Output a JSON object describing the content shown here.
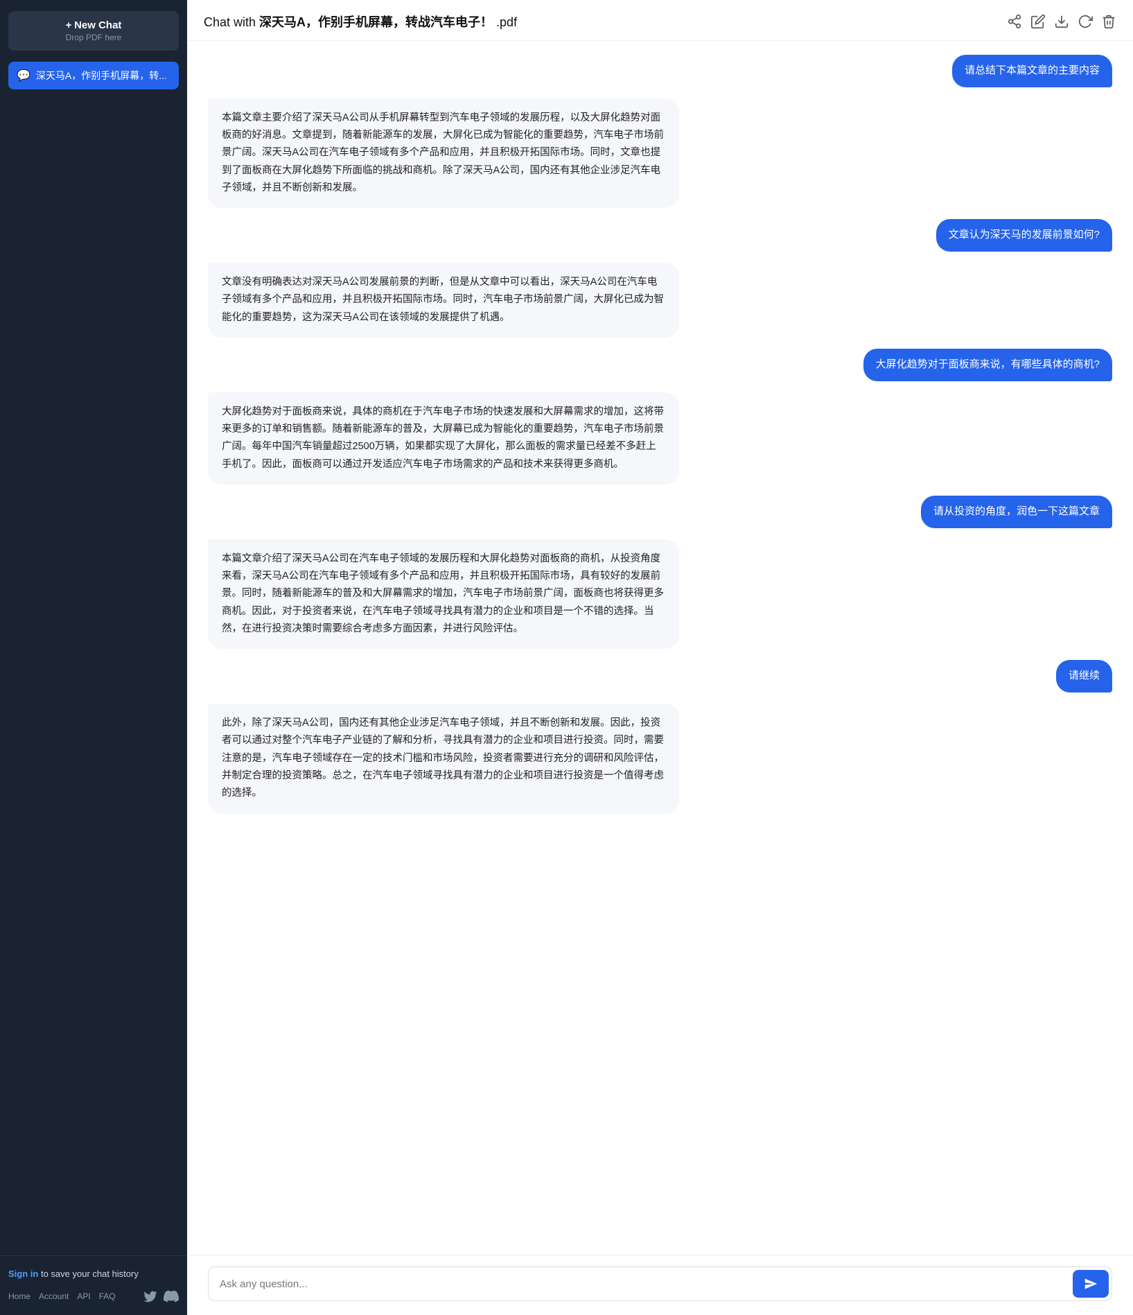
{
  "sidebar": {
    "new_chat_plus": "+",
    "new_chat_label": "New Chat",
    "new_chat_sub": "Drop PDF here",
    "chat_items": [
      {
        "id": 1,
        "label": "深天马A，作别手机屏幕，转..."
      }
    ]
  },
  "sign_in": {
    "prefix": "Sign in",
    "suffix": " to save your chat history"
  },
  "footer": {
    "links": [
      "Home",
      "Account",
      "API",
      "FAQ"
    ]
  },
  "header": {
    "title_prefix": "Chat with ",
    "title_bold": "深天马A，作别手机屏幕，转战汽车电子！",
    "title_suffix": " .pdf"
  },
  "messages": [
    {
      "type": "user",
      "text": "请总结下本篇文章的主要内容"
    },
    {
      "type": "bot",
      "text": "本篇文章主要介绍了深天马A公司从手机屏幕转型到汽车电子领域的发展历程，以及大屏化趋势对面板商的好消息。文章提到，随着新能源车的发展，大屏化已成为智能化的重要趋势，汽车电子市场前景广阔。深天马A公司在汽车电子领域有多个产品和应用，并且积极开拓国际市场。同时，文章也提到了面板商在大屏化趋势下所面临的挑战和商机。除了深天马A公司，国内还有其他企业涉足汽车电子领域，并且不断创新和发展。"
    },
    {
      "type": "user",
      "text": "文章认为深天马的发展前景如何?"
    },
    {
      "type": "bot",
      "text": "文章没有明确表达对深天马A公司发展前景的判断，但是从文章中可以看出，深天马A公司在汽车电子领域有多个产品和应用，并且积极开拓国际市场。同时，汽车电子市场前景广阔，大屏化已成为智能化的重要趋势，这为深天马A公司在该领域的发展提供了机遇。"
    },
    {
      "type": "user",
      "text": "大屏化趋势对于面板商来说，有哪些具体的商机?"
    },
    {
      "type": "bot",
      "text": "大屏化趋势对于面板商来说，具体的商机在于汽车电子市场的快速发展和大屏幕需求的增加，这将带来更多的订单和销售额。随着新能源车的普及，大屏幕已成为智能化的重要趋势，汽车电子市场前景广阔。每年中国汽车销量超过2500万辆，如果都实现了大屏化，那么面板的需求量已经差不多赶上手机了。因此，面板商可以通过开发适应汽车电子市场需求的产品和技术来获得更多商机。"
    },
    {
      "type": "user",
      "text": "请从投资的角度，润色一下这篇文章"
    },
    {
      "type": "bot",
      "text": "本篇文章介绍了深天马A公司在汽车电子领域的发展历程和大屏化趋势对面板商的商机，从投资角度来看，深天马A公司在汽车电子领域有多个产品和应用，并且积极开拓国际市场，具有较好的发展前景。同时，随着新能源车的普及和大屏幕需求的增加，汽车电子市场前景广阔，面板商也将获得更多商机。因此，对于投资者来说，在汽车电子领域寻找具有潜力的企业和项目是一个不错的选择。当然，在进行投资决策时需要综合考虑多方面因素，并进行风险评估。"
    },
    {
      "type": "user",
      "text": "请继续"
    },
    {
      "type": "bot",
      "text": "此外，除了深天马A公司，国内还有其他企业涉足汽车电子领域，并且不断创新和发展。因此，投资者可以通过对整个汽车电子产业链的了解和分析，寻找具有潜力的企业和项目进行投资。同时，需要注意的是，汽车电子领域存在一定的技术门槛和市场风险，投资者需要进行充分的调研和风险评估，并制定合理的投资策略。总之，在汽车电子领域寻找具有潜力的企业和项目进行投资是一个值得考虑的选择。"
    }
  ],
  "input": {
    "placeholder": "Ask any question..."
  },
  "icons": {
    "share": "share-icon",
    "edit": "edit-icon",
    "download": "download-icon",
    "refresh": "refresh-icon",
    "delete": "delete-icon",
    "send": "send-icon"
  }
}
